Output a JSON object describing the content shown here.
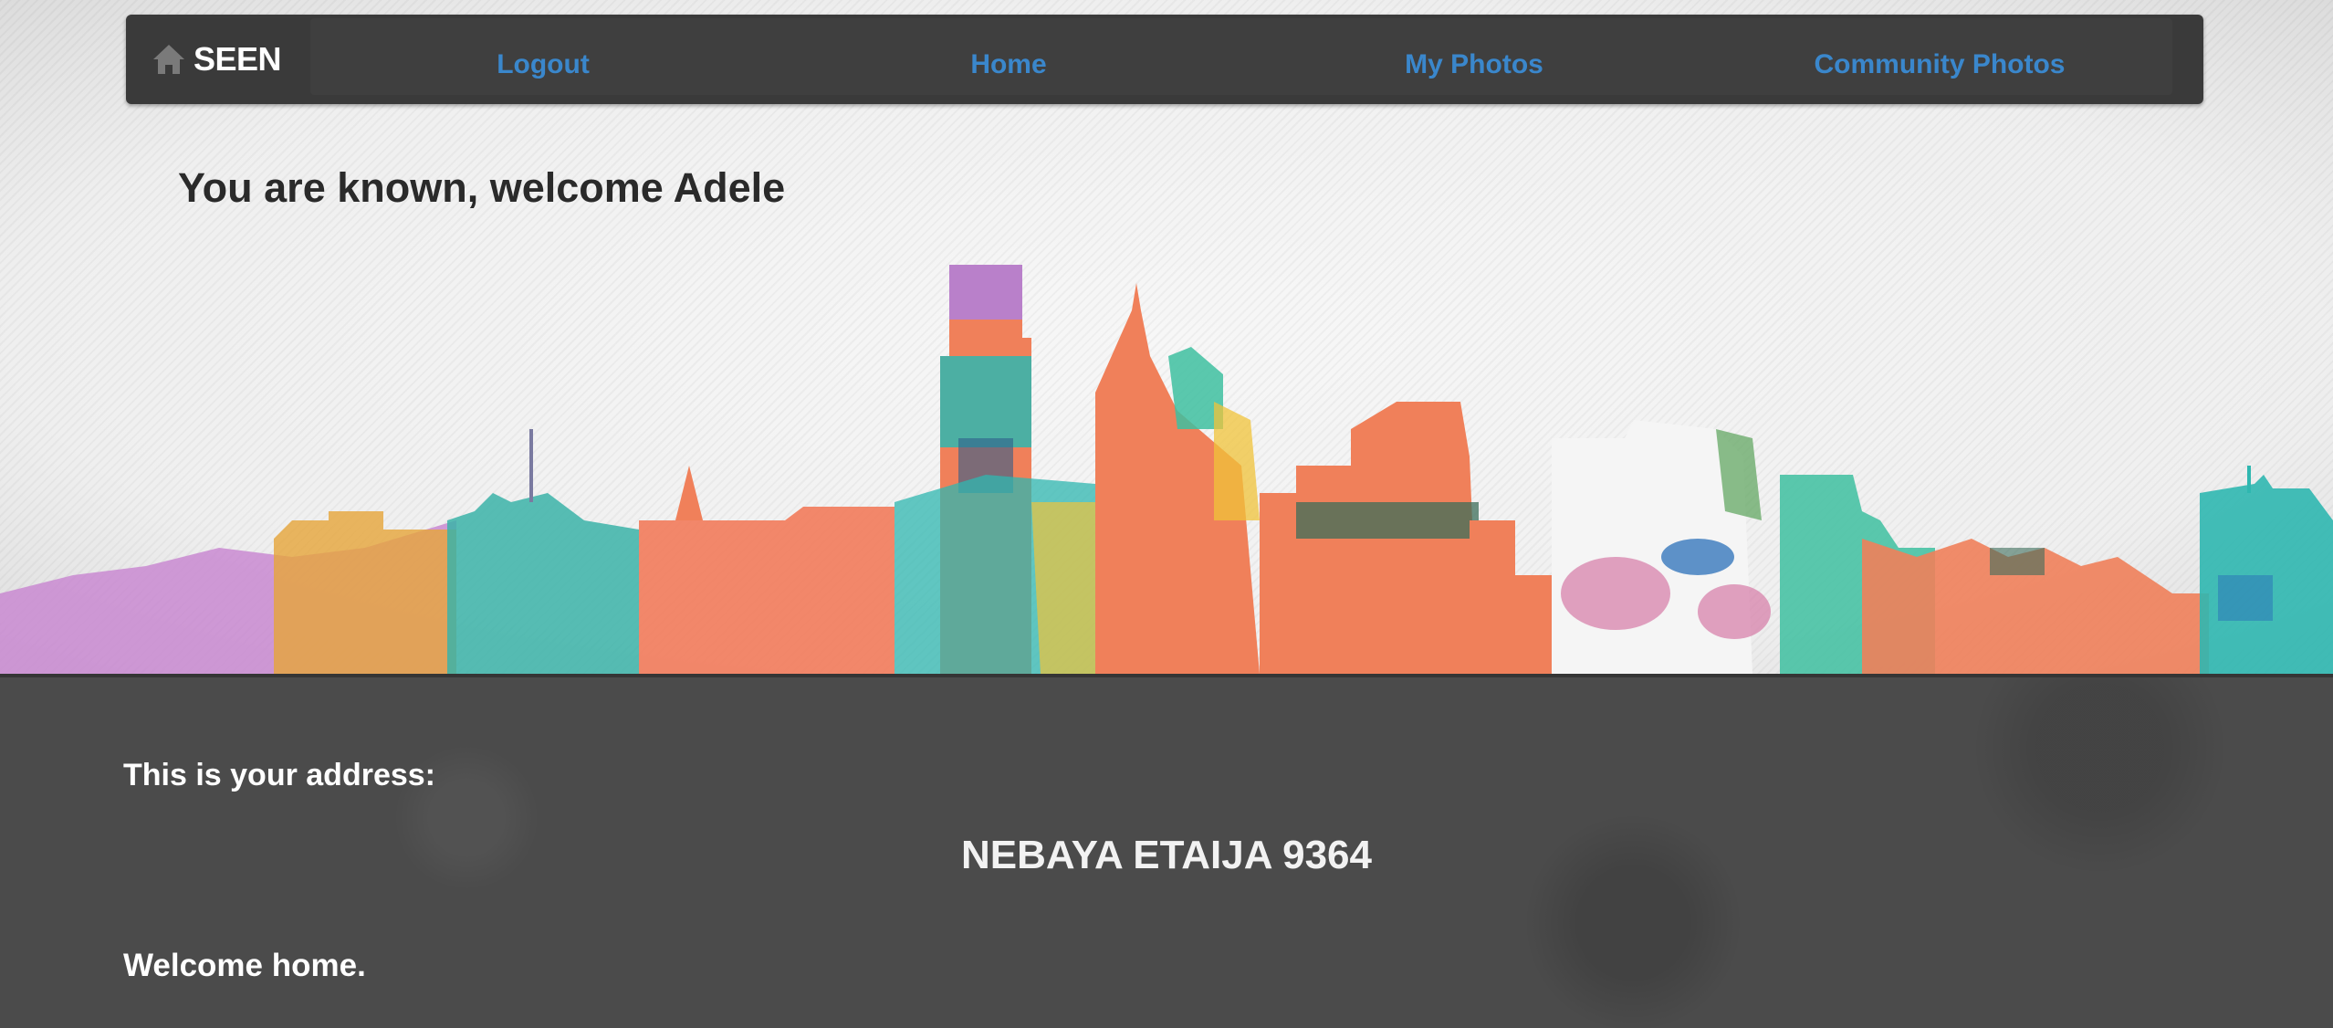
{
  "brand": {
    "label": "SEEN",
    "icon": "home-icon"
  },
  "nav": {
    "links": [
      {
        "label": "Logout"
      },
      {
        "label": "Home"
      },
      {
        "label": "My Photos"
      },
      {
        "label": "Community Photos"
      }
    ],
    "link_color": "#3a87cc"
  },
  "hero": {
    "welcome": "You are known, welcome Adele"
  },
  "panel": {
    "address_label": "This is your address:",
    "address": "NEBAYA ETAIJA 9364",
    "closing": "Welcome home."
  }
}
